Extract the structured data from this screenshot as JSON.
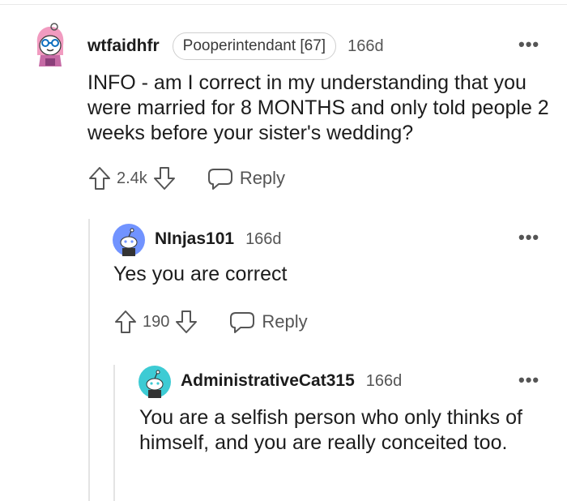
{
  "comments": [
    {
      "username": "wtfaidhfr",
      "flair": "Pooperintendant [67]",
      "age": "166d",
      "body": "INFO - am I correct in my understanding that you were married for 8 MONTHS and only told people 2 weeks before your sister's wedding?",
      "votes": "2.4k",
      "reply_label": "Reply",
      "avatar_icon": "snoo-avatar-pink-hood"
    },
    {
      "username": "NInjas101",
      "age": "166d",
      "body": "Yes you are correct",
      "votes": "190",
      "reply_label": "Reply",
      "avatar_icon": "snoo-default-avatar-blue"
    },
    {
      "username": "AdministrativeCat315",
      "age": "166d",
      "body": "You are a selfish person who only thinks of himself, and you are really conceited too.",
      "avatar_icon": "snoo-default-avatar-teal"
    }
  ],
  "more_icon": "•••",
  "colors": {
    "avatar_blue": "#7193ff",
    "avatar_teal": "#3dcbd4",
    "avatar_pink": "#ff9ec7",
    "thread_line": "#e4e4e4",
    "muted_text": "#555555"
  }
}
